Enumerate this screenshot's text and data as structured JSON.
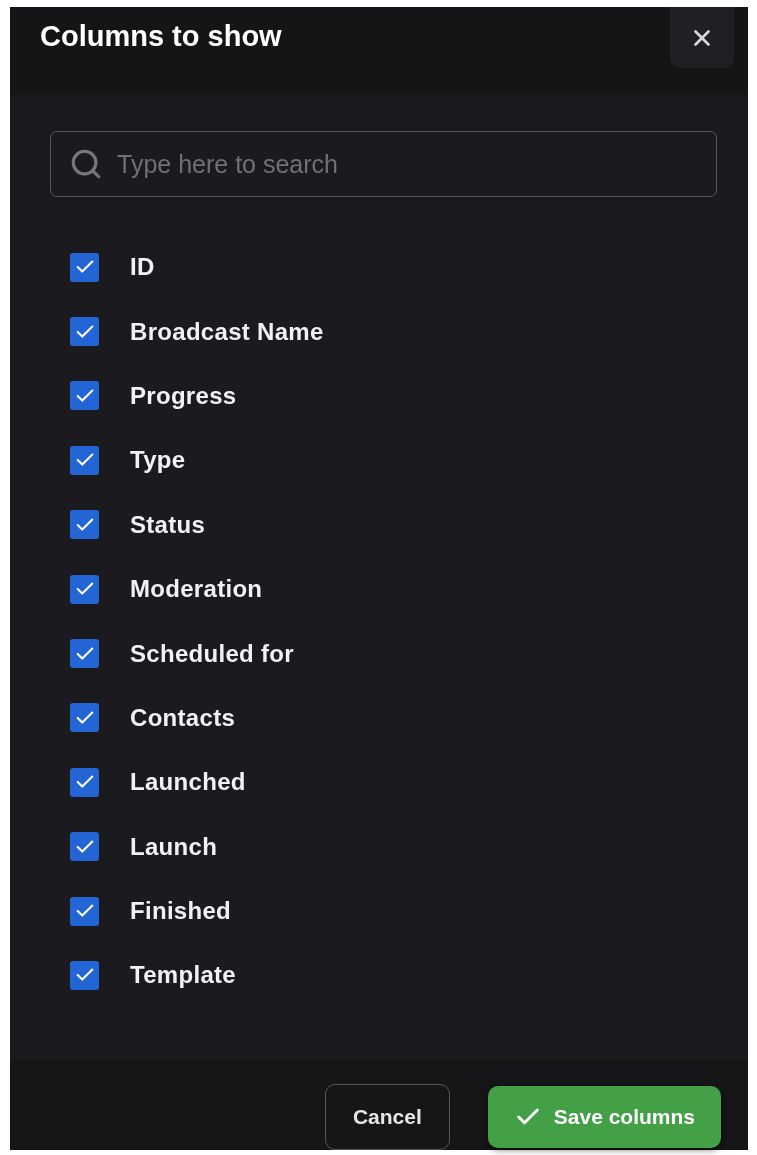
{
  "dialog": {
    "title": "Columns to show",
    "search": {
      "placeholder": "Type here to search"
    },
    "columns": [
      {
        "label": "ID",
        "checked": true
      },
      {
        "label": "Broadcast Name",
        "checked": true
      },
      {
        "label": "Progress",
        "checked": true
      },
      {
        "label": "Type",
        "checked": true
      },
      {
        "label": "Status",
        "checked": true
      },
      {
        "label": "Moderation",
        "checked": true
      },
      {
        "label": "Scheduled for",
        "checked": true
      },
      {
        "label": "Contacts",
        "checked": true
      },
      {
        "label": "Launched",
        "checked": true
      },
      {
        "label": "Launch",
        "checked": true
      },
      {
        "label": "Finished",
        "checked": true
      },
      {
        "label": "Template",
        "checked": true
      }
    ],
    "buttons": [
      {
        "label": "Cancel",
        "kind": "secondary"
      },
      {
        "label": "Save columns",
        "kind": "primary"
      }
    ]
  }
}
